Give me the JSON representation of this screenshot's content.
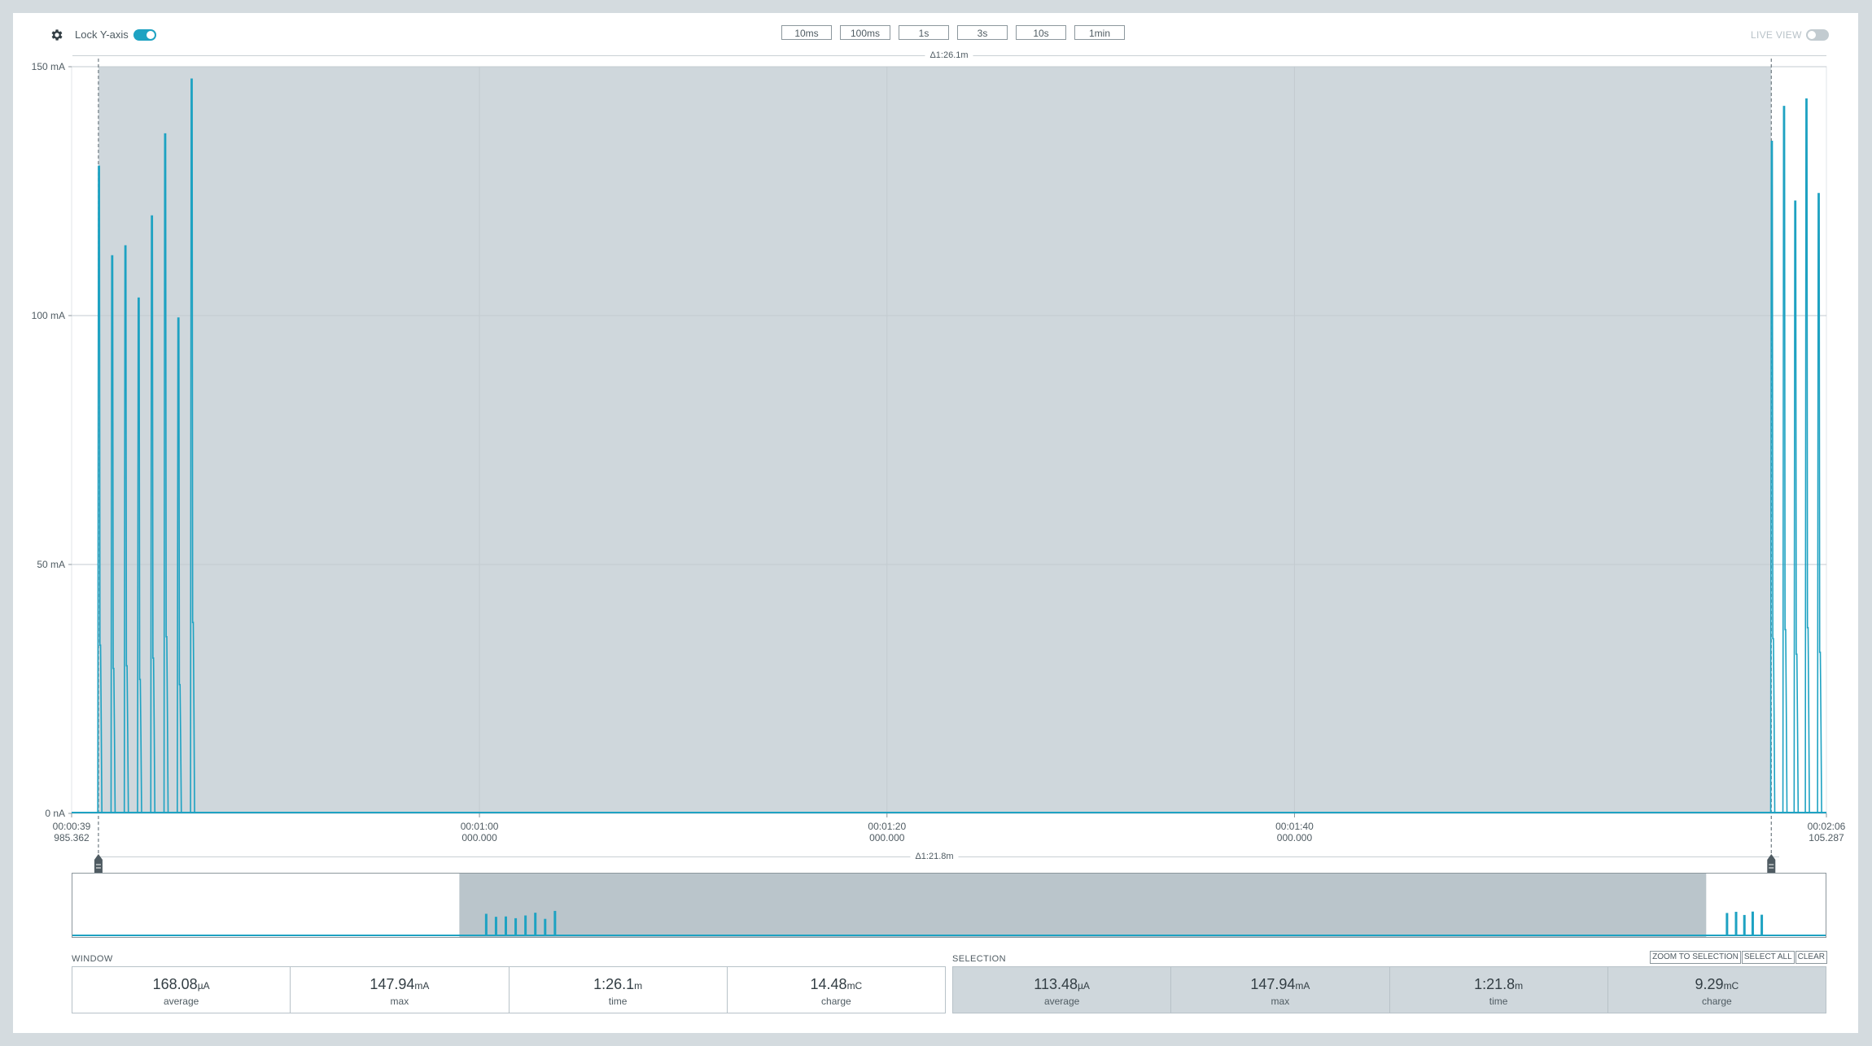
{
  "toolbar": {
    "lock_label": "Lock Y-axis",
    "live_label": "LIVE VIEW",
    "window_buttons": [
      "10ms",
      "100ms",
      "1s",
      "3s",
      "10s",
      "1min"
    ]
  },
  "window_delta": "Δ1:26.1m",
  "selection_delta": "Δ1:21.8m",
  "colors": {
    "accent": "#1ea2c2",
    "selection": "#cfd7dc",
    "minimap_selection": "#bac5cb"
  },
  "icons": {
    "gear": "gear-icon",
    "cursor": "cursor-handle-icon"
  },
  "chart_data": {
    "type": "line",
    "ylabel": "",
    "xlabel": "",
    "ylim": [
      0,
      150
    ],
    "xlim": [
      39.985,
      126.105
    ],
    "y_ticks": [
      {
        "value": 0,
        "label": "0 nA"
      },
      {
        "value": 50,
        "label": "50 mA"
      },
      {
        "value": 100,
        "label": "100 mA"
      },
      {
        "value": 150,
        "label": "150 mA"
      }
    ],
    "x_ticks": [
      {
        "value": 39.985,
        "line1": "00:00:39",
        "line2": "985.362"
      },
      {
        "value": 60,
        "line1": "00:01:00",
        "line2": "000.000"
      },
      {
        "value": 80,
        "line1": "00:01:20",
        "line2": "000.000"
      },
      {
        "value": 100,
        "line1": "00:01:40",
        "line2": "000.000"
      },
      {
        "value": 126.105,
        "line1": "00:02:06",
        "line2": "105.287"
      }
    ],
    "grid": true,
    "selection": {
      "start": 41.3,
      "end": 123.4
    },
    "peaks": [
      {
        "x": 41.35,
        "y": 130
      },
      {
        "x": 42.0,
        "y": 112
      },
      {
        "x": 42.65,
        "y": 114
      },
      {
        "x": 43.3,
        "y": 103.5
      },
      {
        "x": 43.95,
        "y": 120
      },
      {
        "x": 44.6,
        "y": 136.5
      },
      {
        "x": 45.25,
        "y": 99.5
      },
      {
        "x": 45.9,
        "y": 147.5
      },
      {
        "x": 123.45,
        "y": 135
      },
      {
        "x": 124.05,
        "y": 142
      },
      {
        "x": 124.6,
        "y": 123
      },
      {
        "x": 125.15,
        "y": 143.5
      },
      {
        "x": 125.75,
        "y": 124.5
      }
    ]
  },
  "minimap": {
    "xlim": [
      14.0,
      130.0
    ],
    "selection": [
      39.6,
      122.1
    ]
  },
  "window_stats": {
    "title": "WINDOW",
    "cells": [
      {
        "value": "168.08",
        "unit": "µA",
        "label": "average"
      },
      {
        "value": "147.94",
        "unit": "mA",
        "label": "max"
      },
      {
        "value": "1:26.1",
        "unit": "m",
        "label": "time"
      },
      {
        "value": "14.48",
        "unit": "mC",
        "label": "charge"
      }
    ]
  },
  "selection_stats": {
    "title": "SELECTION",
    "actions": [
      "ZOOM TO SELECTION",
      "SELECT ALL",
      "CLEAR"
    ],
    "cells": [
      {
        "value": "113.48",
        "unit": "µA",
        "label": "average"
      },
      {
        "value": "147.94",
        "unit": "mA",
        "label": "max"
      },
      {
        "value": "1:21.8",
        "unit": "m",
        "label": "time"
      },
      {
        "value": "9.29",
        "unit": "mC",
        "label": "charge"
      }
    ]
  }
}
